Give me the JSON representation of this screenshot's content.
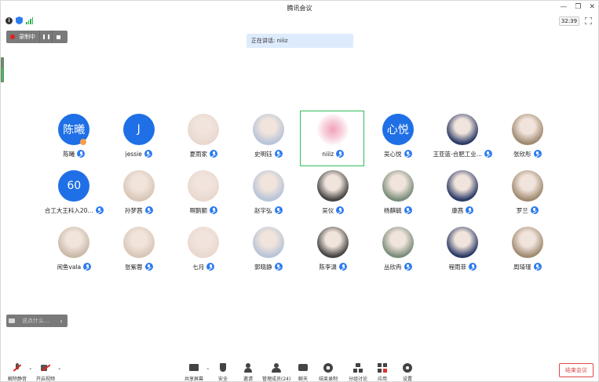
{
  "window": {
    "title": "腾讯会议",
    "timer": "32:39"
  },
  "recording": {
    "label": "录制中"
  },
  "speaking": {
    "text": "正在讲话: niiiz"
  },
  "chat": {
    "placeholder": "说点什么..."
  },
  "participants": [
    {
      "name": "陈曦",
      "avatar_text": "陈曦",
      "avatar_type": "blue"
    },
    {
      "name": "jessie",
      "avatar_text": "J",
      "avatar_type": "blue"
    },
    {
      "name": "夏雨家",
      "avatar_text": "",
      "avatar_type": "photo"
    },
    {
      "name": "史明钰",
      "avatar_text": "",
      "avatar_type": "photo"
    },
    {
      "name": "niiiz",
      "avatar_text": "",
      "avatar_type": "blur",
      "speaking": true
    },
    {
      "name": "吴心悦",
      "avatar_text": "心悦",
      "avatar_type": "blue"
    },
    {
      "name": "王亚蓝-合肥工业...",
      "avatar_text": "",
      "avatar_type": "photo"
    },
    {
      "name": "张欣彤",
      "avatar_text": "",
      "avatar_type": "photo"
    },
    {
      "name": "合工大王科入20...",
      "avatar_text": "60",
      "avatar_type": "blue"
    },
    {
      "name": "孙梦茜",
      "avatar_text": "",
      "avatar_type": "photo"
    },
    {
      "name": "啊鹅额",
      "avatar_text": "",
      "avatar_type": "photo"
    },
    {
      "name": "赵宇弘",
      "avatar_text": "",
      "avatar_type": "photo"
    },
    {
      "name": "吴仪",
      "avatar_text": "",
      "avatar_type": "photo"
    },
    {
      "name": "杨麒毓",
      "avatar_text": "",
      "avatar_type": "photo"
    },
    {
      "name": "康茜",
      "avatar_text": "",
      "avatar_type": "photo"
    },
    {
      "name": "罗兰",
      "avatar_text": "",
      "avatar_type": "photo"
    },
    {
      "name": "闲鱼vala",
      "avatar_text": "",
      "avatar_type": "photo"
    },
    {
      "name": "张紫蓉",
      "avatar_text": "",
      "avatar_type": "photo"
    },
    {
      "name": "七月",
      "avatar_text": "",
      "avatar_type": "photo"
    },
    {
      "name": "郭晓静",
      "avatar_text": "",
      "avatar_type": "photo"
    },
    {
      "name": "陈李潇",
      "avatar_text": "",
      "avatar_type": "photo"
    },
    {
      "name": "丛欣冉",
      "avatar_text": "",
      "avatar_type": "photo"
    },
    {
      "name": "程雨菲",
      "avatar_text": "",
      "avatar_type": "photo"
    },
    {
      "name": "周琦瑾",
      "avatar_text": "",
      "avatar_type": "photo"
    }
  ],
  "toolbar": {
    "unmute": "解除静音",
    "start_video": "开启视频",
    "share_screen": "共享屏幕",
    "security": "安全",
    "invite": "邀请",
    "manage_members": "管理成员(24)",
    "chat": "聊天",
    "end_recording": "结束录制",
    "breakout": "分组讨论",
    "apps": "应用",
    "settings": "设置",
    "end_meeting": "结束会议"
  }
}
